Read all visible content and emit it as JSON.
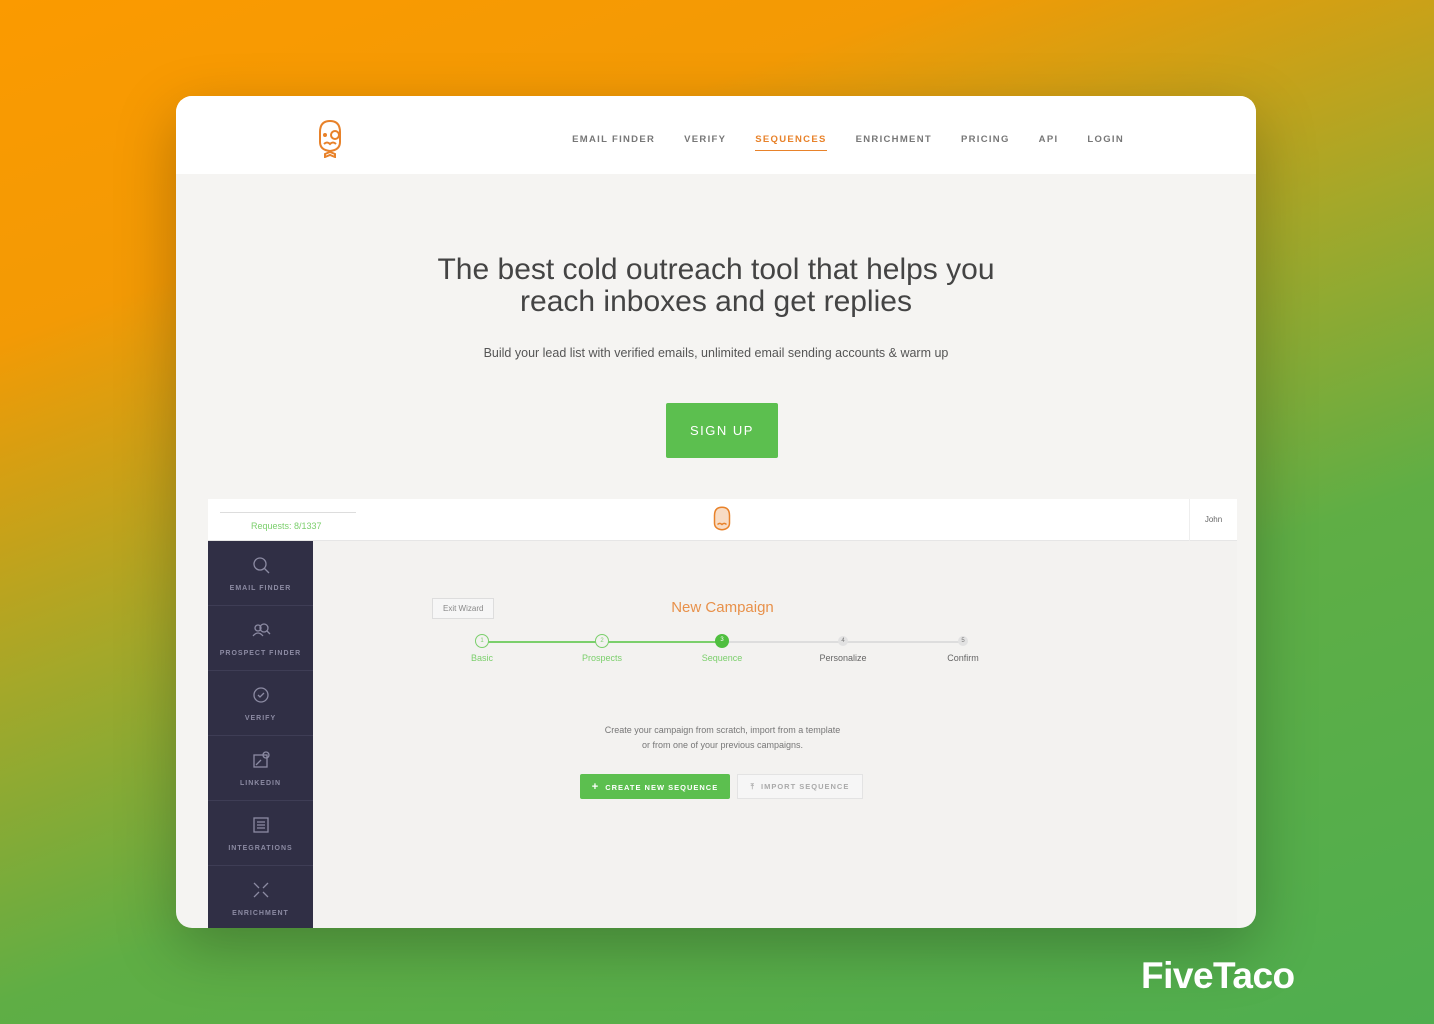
{
  "nav": {
    "items": [
      {
        "label": "EMAIL FINDER"
      },
      {
        "label": "VERIFY"
      },
      {
        "label": "SEQUENCES",
        "active": true
      },
      {
        "label": "ENRICHMENT"
      },
      {
        "label": "PRICING"
      },
      {
        "label": "API"
      },
      {
        "label": "LOGIN"
      }
    ]
  },
  "hero": {
    "title_line1": "The best cold outreach tool that helps you",
    "title_line2": "reach inboxes and get replies",
    "subtitle": "Build your lead list with verified emails, unlimited email sending accounts & warm up",
    "cta": "SIGN UP"
  },
  "app": {
    "requests": "Requests: 8/1337",
    "user": "John",
    "exit": "Exit Wizard",
    "campaign_title": "New Campaign",
    "sidebar": [
      {
        "label": "EMAIL FINDER",
        "icon": "search-icon"
      },
      {
        "label": "PROSPECT FINDER",
        "icon": "people-search-icon"
      },
      {
        "label": "VERIFY",
        "icon": "check-circle-icon"
      },
      {
        "label": "LINKEDIN",
        "icon": "linkedin-extension-icon"
      },
      {
        "label": "INTEGRATIONS",
        "icon": "list-icon"
      },
      {
        "label": "ENRICHMENT",
        "icon": "arrows-in-icon"
      }
    ],
    "steps": [
      {
        "num": "1",
        "label": "Basic",
        "state": "done"
      },
      {
        "num": "2",
        "label": "Prospects",
        "state": "done"
      },
      {
        "num": "3",
        "label": "Sequence",
        "state": "active"
      },
      {
        "num": "4",
        "label": "Personalize",
        "state": "todo"
      },
      {
        "num": "5",
        "label": "Confirm",
        "state": "todo"
      }
    ],
    "desc_line1": "Create your campaign from scratch, import from a template",
    "desc_line2": "or from one of your previous campaigns.",
    "create_label": "CREATE NEW SEQUENCE",
    "import_label": "IMPORT SEQUENCE"
  },
  "brand": "FiveTaco",
  "colors": {
    "accent": "#e8822a",
    "green": "#5cbf4f",
    "sidebar": "#302f45"
  }
}
